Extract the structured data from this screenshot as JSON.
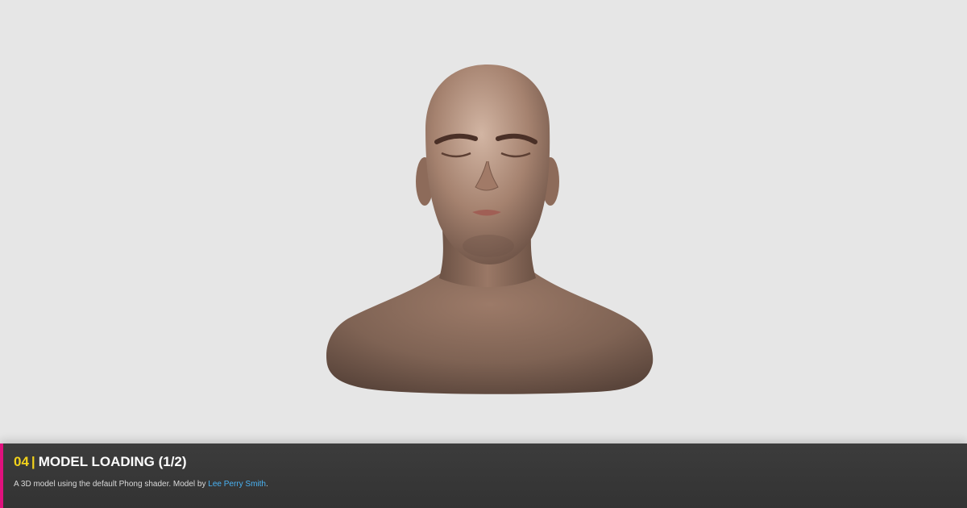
{
  "viewer": {
    "background_color": "#e6e6e6",
    "model_name": "head-bust",
    "skin_color": "#8a6e5f"
  },
  "info": {
    "number": "04",
    "separator": "|",
    "title": "MODEL LOADING (1/2)",
    "description_prefix": "A 3D model using the default Phong shader. Model by ",
    "author_link": "Lee Perry Smith",
    "description_suffix": ".",
    "accent_color": "#e0117d",
    "number_color": "#f2d21b",
    "link_color": "#4ab3f4"
  }
}
